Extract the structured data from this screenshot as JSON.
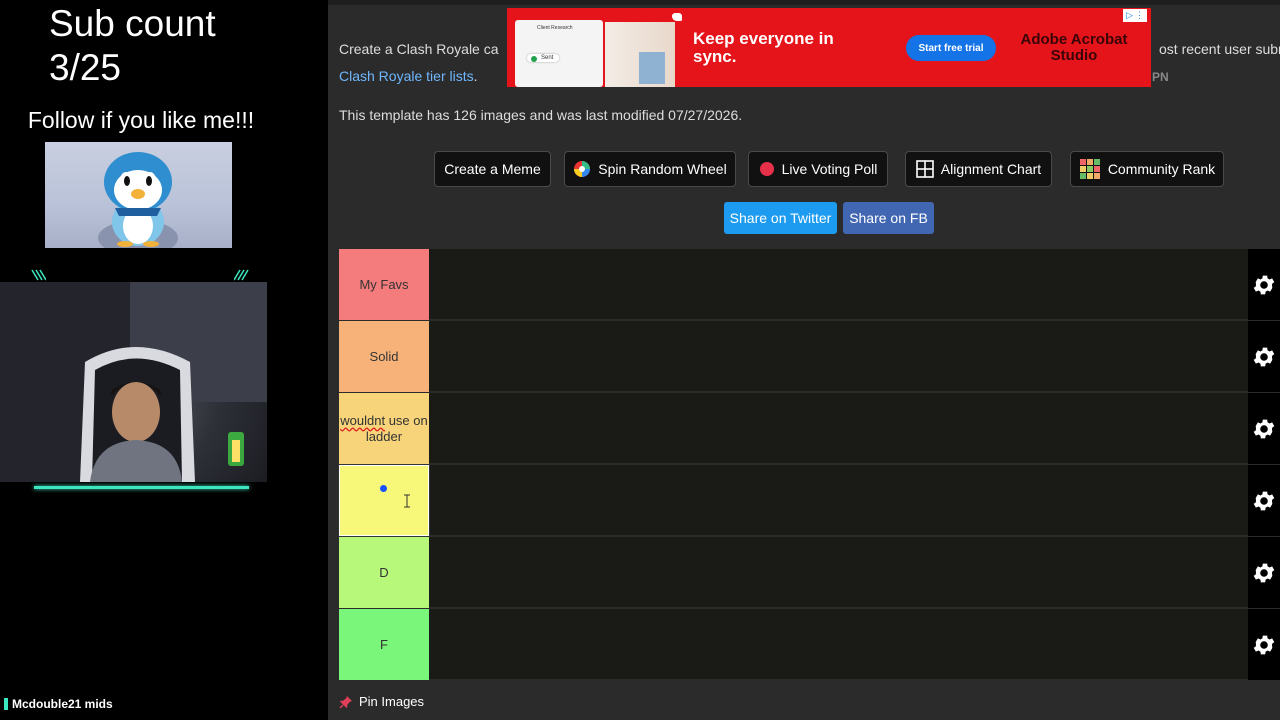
{
  "overlay": {
    "sub_count_title": "Sub count",
    "sub_count_value": "3/25",
    "follow_text": "Follow if you like me!!!",
    "username": "Mcdouble21  mids",
    "accent_color": "#3ce6c0"
  },
  "page": {
    "intro_text": "Create a Clash Royale ca",
    "intro_right_text": "ost recent user subr",
    "intro_link": "Clash Royale tier lists",
    "intro_link_suffix": ".",
    "pn_text": "PN",
    "template_info": "This template has 126 images and was last modified 07/27/2026."
  },
  "ad": {
    "doc_title": "Client Research",
    "sent_label": "Sent",
    "headline": "Keep everyone in sync.",
    "cta": "Start free trial",
    "brand": "Adobe Acrobat Studio",
    "background": "#e5141b"
  },
  "actions": [
    {
      "label": "Create a Meme",
      "icon": "none"
    },
    {
      "label": "Spin Random Wheel",
      "icon": "wheel-icon"
    },
    {
      "label": "Live Voting Poll",
      "icon": "red-dot-icon"
    },
    {
      "label": "Alignment Chart",
      "icon": "grid-icon"
    },
    {
      "label": "Community Rank",
      "icon": "rank-grid-icon"
    }
  ],
  "share": {
    "twitter": "Share on Twitter",
    "facebook": "Share on FB",
    "twitter_color": "#1d9bf0",
    "facebook_color": "#4267b2"
  },
  "tiers": [
    {
      "label": "My Favs",
      "color": "#f47c7c"
    },
    {
      "label_part1": "wouldnt",
      "label_part2": " use on ladder",
      "color": "#f7d47a",
      "note": "row 3"
    },
    {
      "label": "Solid",
      "color": "#f7b27a"
    },
    {
      "label": "",
      "color": "#f7f77a"
    },
    {
      "label": "D",
      "color": "#b7f77a"
    },
    {
      "label": "F",
      "color": "#7af77a"
    }
  ],
  "pin_images": "Pin Images"
}
